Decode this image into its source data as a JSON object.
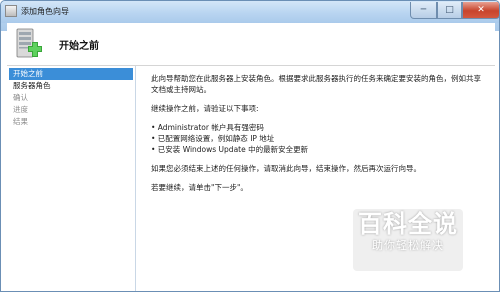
{
  "window": {
    "title": "添加角色向导",
    "min_glyph": "─",
    "max_glyph": "□",
    "close_glyph": "✕"
  },
  "header": {
    "title": "开始之前",
    "icon": "server-add-icon"
  },
  "nav": {
    "items": [
      {
        "label": "开始之前",
        "state": "active"
      },
      {
        "label": "服务器角色",
        "state": "enabled"
      },
      {
        "label": "确认",
        "state": "disabled"
      },
      {
        "label": "进度",
        "state": "disabled"
      },
      {
        "label": "结果",
        "state": "disabled"
      }
    ]
  },
  "content": {
    "intro": "此向导帮助您在此服务器上安装角色。根据要求此服务器执行的任务来确定要安装的角色，例如共享文档或主持网站。",
    "verify_intro": "继续操作之前，请验证以下事项:",
    "bullets": [
      "• Administrator 帐户具有强密码",
      "• 已配置网络设置，例如静态 IP 地址",
      "• 已安装 Windows Update 中的最新安全更新"
    ],
    "cancel_note": "如果您必须结束上述的任何操作，请取消此向导，结束操作，然后再次运行向导。",
    "continue_note": "若要继续，请单击\"下一步\"。"
  },
  "watermark": {
    "main": "百科全说",
    "sub": "助你轻松解决"
  },
  "colors": {
    "accent": "#3b8ed8",
    "close_button": "#c8442c",
    "titlebar": "#b9d5f1"
  }
}
